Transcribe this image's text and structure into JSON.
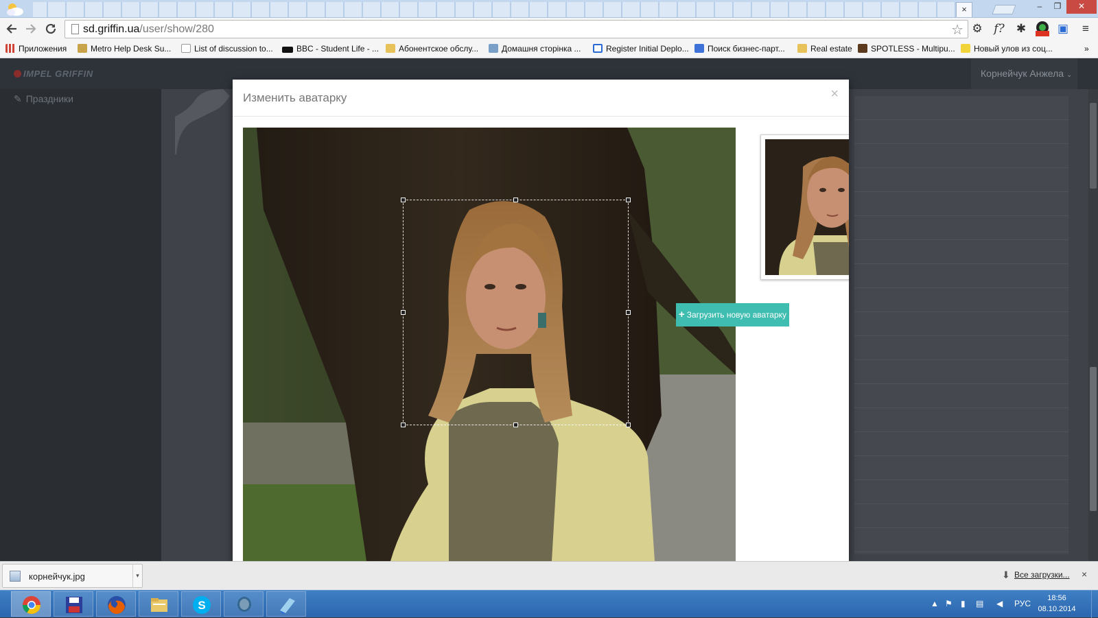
{
  "browser": {
    "tab_close_glyph": "×",
    "window_controls": [
      "–",
      "❐",
      "✕"
    ],
    "url_host": "sd.griffin.ua",
    "url_path": "/user/show/280",
    "bookmarks": [
      {
        "label": "Приложения",
        "icon": "apps-grid-icon",
        "color": "#d04437"
      },
      {
        "label": "Metro Help Desk Su...",
        "icon": "bookmark-icon",
        "color": "#c8a34a"
      },
      {
        "label": "List of discussion to...",
        "icon": "page-icon",
        "color": "#ffffff"
      },
      {
        "label": "BBC - Student Life - ...",
        "icon": "bbc-icon",
        "color": "#111111"
      },
      {
        "label": "Абонентское обслу...",
        "icon": "folder-icon",
        "color": "#e7c25b"
      },
      {
        "label": "Домашня сторінка ...",
        "icon": "site-icon",
        "color": "#7aa0c8"
      },
      {
        "label": "Register Initial Deplo...",
        "icon": "calendar-icon",
        "color": "#2a6ad4"
      },
      {
        "label": "Поиск бизнес-парт...",
        "icon": "google-icon",
        "color": "#3f72d8"
      },
      {
        "label": "Real estate",
        "icon": "folder-icon",
        "color": "#e7c25b"
      },
      {
        "label": "SPOTLESS - Multipu...",
        "icon": "spotless-icon",
        "color": "#5b3a1e"
      },
      {
        "label": "Новый улов из соц...",
        "icon": "fish-icon",
        "color": "#f0d43a"
      }
    ],
    "bookmarks_more": "»"
  },
  "app": {
    "logo": "IMPEL GRIFFIN",
    "user_menu": "Корнейчук Анжела",
    "sidebar_item": "Праздники"
  },
  "modal": {
    "title": "Изменить аватарку",
    "close_glyph": "×",
    "upload_label": "Загрузить новую аватарку",
    "upload_plus": "+"
  },
  "downloads": {
    "file_name": "корнейчук.jpg",
    "all_label": "Все загрузки...",
    "close_glyph": "×"
  },
  "taskbar": {
    "apps": [
      "chrome-icon",
      "floppy-icon",
      "firefox-icon",
      "explorer-icon",
      "skype-icon",
      "postgres-icon",
      "notes-icon"
    ],
    "language": "РУС",
    "time": "18:56",
    "date": "08.10.2014"
  },
  "colors": {
    "accent": "#3ebdb0",
    "app_nav": "#2e333a",
    "taskbar": "#2b66ae"
  }
}
